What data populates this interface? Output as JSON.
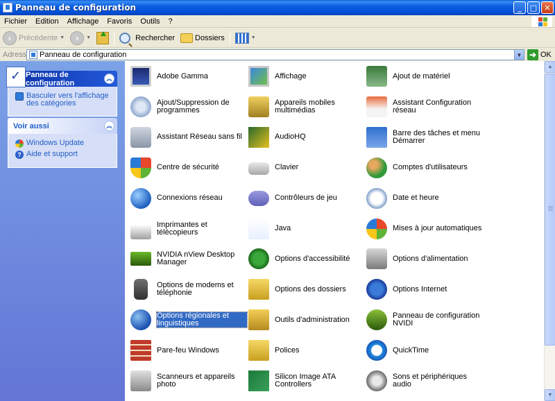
{
  "window": {
    "title": "Panneau de configuration"
  },
  "menu": [
    "Fichier",
    "Edition",
    "Affichage",
    "Favoris",
    "Outils",
    "?"
  ],
  "toolbar": {
    "back": "Précédente",
    "search": "Rechercher",
    "folders": "Dossiers"
  },
  "address": {
    "label": "Adresse",
    "value": "Panneau de configuration",
    "go": "OK"
  },
  "sidebar": {
    "panel1": {
      "title": "Panneau de configuration",
      "link": "Basculer vers l'affichage des catégories"
    },
    "panel2": {
      "title": "Voir aussi",
      "links": [
        "Windows Update",
        "Aide et support"
      ]
    }
  },
  "items": [
    {
      "label": "Adobe Gamma",
      "icon": "monitor-icon"
    },
    {
      "label": "Affichage",
      "icon": "display-icon"
    },
    {
      "label": "Ajout de matériel",
      "icon": "hardware-icon"
    },
    {
      "label": "Ajout/Suppression de programmes",
      "icon": "add-remove-programs-icon"
    },
    {
      "label": "Appareils mobiles multimédias",
      "icon": "mobile-devices-icon"
    },
    {
      "label": "Assistant Configuration réseau",
      "icon": "network-setup-icon"
    },
    {
      "label": "Assistant Réseau sans fil",
      "icon": "wireless-icon"
    },
    {
      "label": "AudioHQ",
      "icon": "audiohq-icon"
    },
    {
      "label": "Barre des tâches et menu Démarrer",
      "icon": "taskbar-icon"
    },
    {
      "label": "Centre de sécurité",
      "icon": "shield-icon"
    },
    {
      "label": "Clavier",
      "icon": "keyboard-icon"
    },
    {
      "label": "Comptes d'utilisateurs",
      "icon": "users-icon"
    },
    {
      "label": "Connexions réseau",
      "icon": "globe-icon"
    },
    {
      "label": "Contrôleurs de jeu",
      "icon": "gamepad-icon"
    },
    {
      "label": "Date et heure",
      "icon": "clock-icon"
    },
    {
      "label": "Imprimantes et télécopieurs",
      "icon": "printer-icon"
    },
    {
      "label": "Java",
      "icon": "java-icon"
    },
    {
      "label": "Mises à jour automatiques",
      "icon": "windows-update-icon"
    },
    {
      "label": "NVIDIA nView Desktop Manager",
      "icon": "nvidia-icon"
    },
    {
      "label": "Options d'accessibilité",
      "icon": "accessibility-icon"
    },
    {
      "label": "Options d'alimentation",
      "icon": "power-icon"
    },
    {
      "label": "Options de modems et téléphonie",
      "icon": "phone-icon"
    },
    {
      "label": "Options des dossiers",
      "icon": "folder-options-icon"
    },
    {
      "label": "Options Internet",
      "icon": "internet-icon"
    },
    {
      "label": "Options régionales et linguistiques",
      "icon": "regional-icon"
    },
    {
      "label": "Outils d'administration",
      "icon": "admin-tools-icon"
    },
    {
      "label": "Panneau de configuration NVIDI",
      "icon": "nvidia-panel-icon"
    },
    {
      "label": "Pare-feu Windows",
      "icon": "firewall-icon"
    },
    {
      "label": "Polices",
      "icon": "fonts-folder-icon"
    },
    {
      "label": "QuickTime",
      "icon": "quicktime-icon"
    },
    {
      "label": "Scanneurs et appareils photo",
      "icon": "scanner-icon"
    },
    {
      "label": "Silicon Image ATA Controllers",
      "icon": "ata-controller-icon"
    },
    {
      "label": "Sons et périphériques audio",
      "icon": "speaker-icon"
    }
  ]
}
